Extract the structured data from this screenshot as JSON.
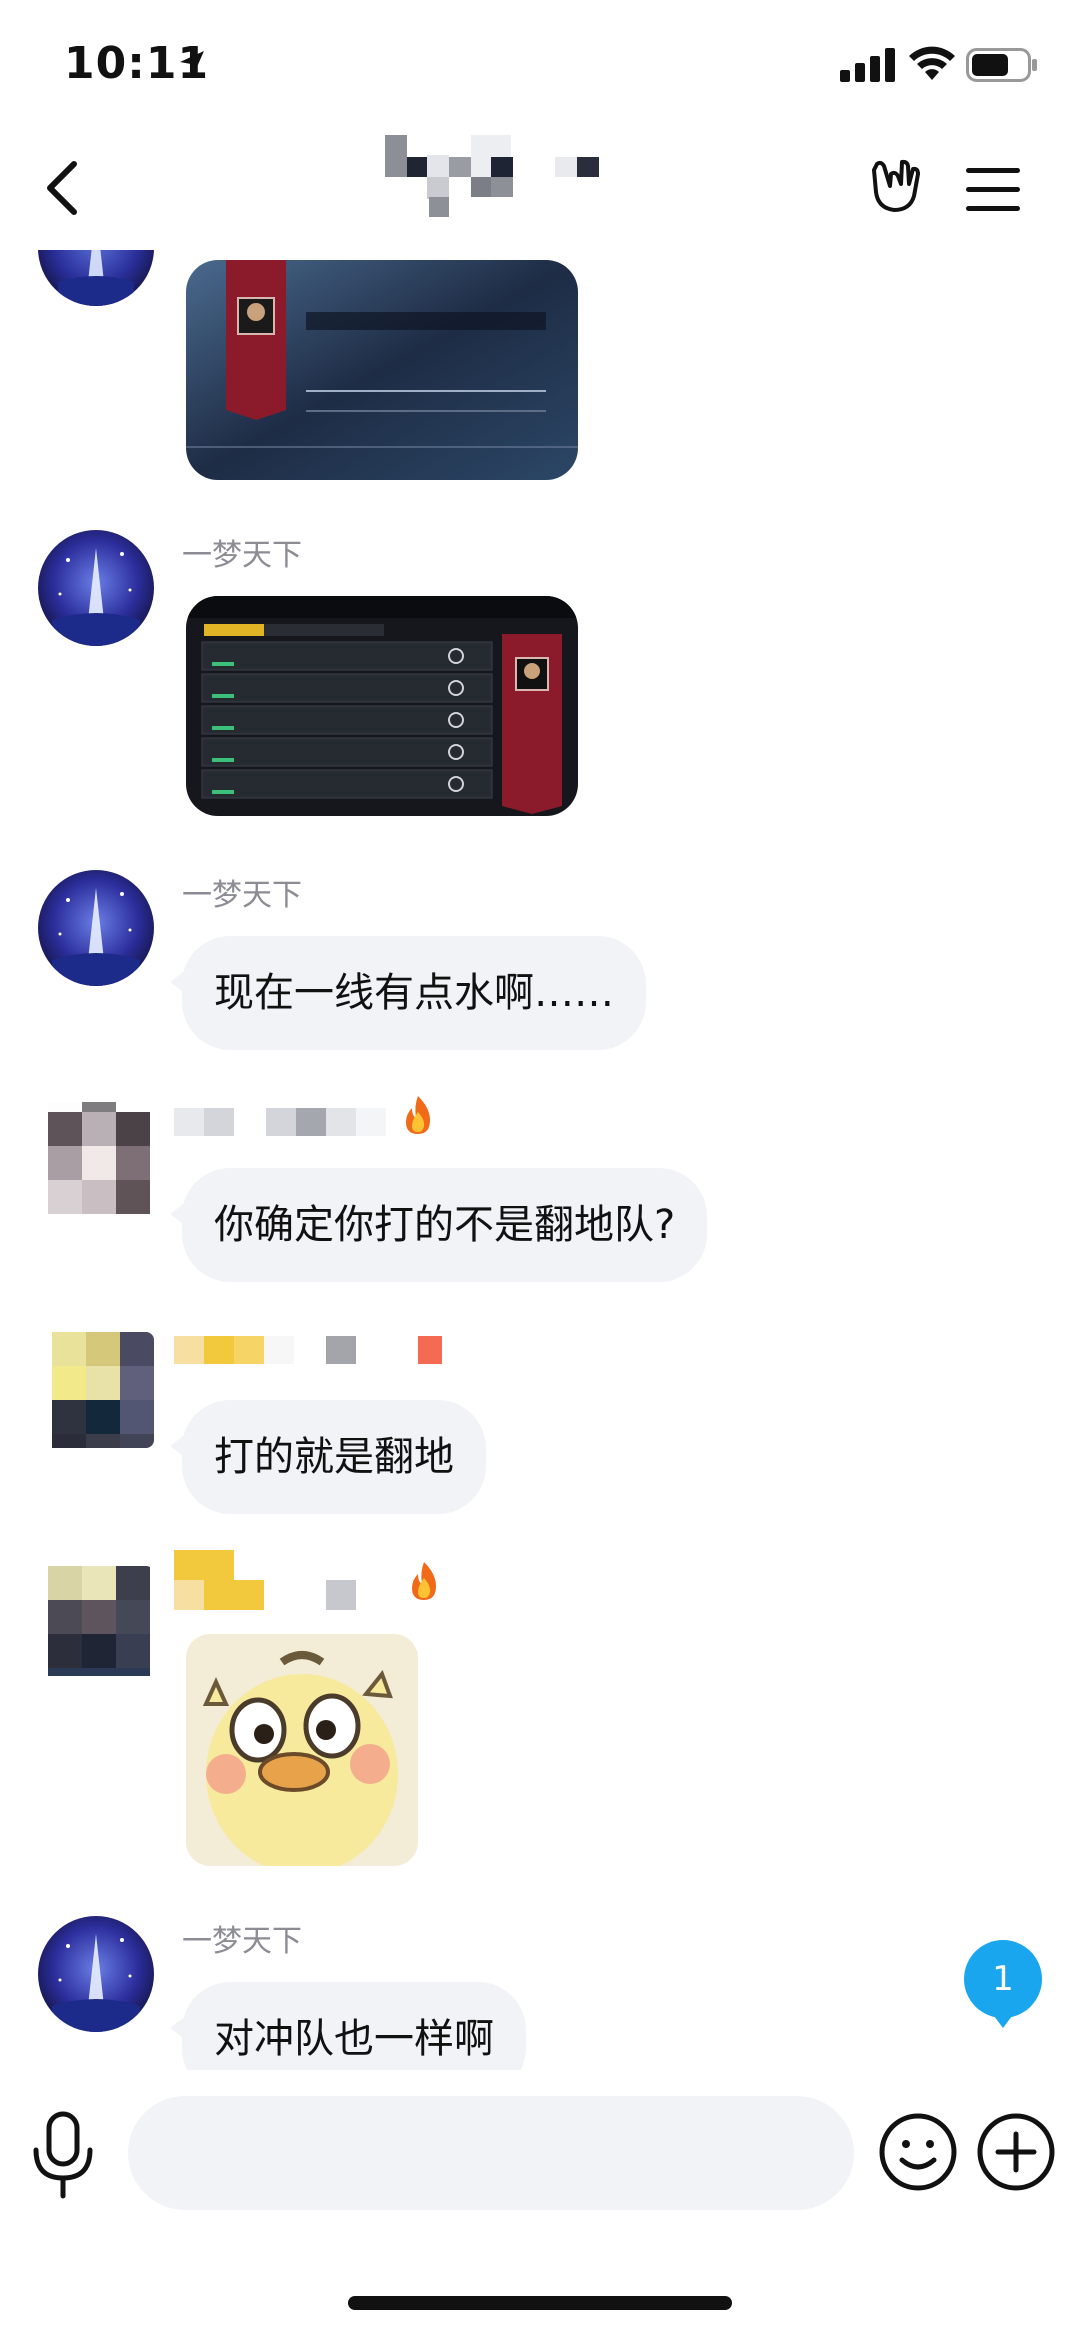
{
  "status_bar": {
    "time": "10:11"
  },
  "header": {
    "back_icon": "chevron-left-icon",
    "hand_icon": "rock-hand-icon",
    "menu_icon": "hamburger-menu-icon"
  },
  "messages": [
    {
      "sender": "",
      "kind": "image",
      "content": "game screenshot (result card)"
    },
    {
      "sender": "一梦天下",
      "kind": "image",
      "content": "game screenshot (match list)"
    },
    {
      "sender": "一梦天下",
      "kind": "text",
      "text": "现在一线有点水啊……"
    },
    {
      "sender": "",
      "kind": "text",
      "text": "你确定你打的不是翻地队?"
    },
    {
      "sender": "",
      "kind": "text",
      "text": "打的就是翻地"
    },
    {
      "sender": "",
      "kind": "sticker",
      "content": "duck sticker"
    },
    {
      "sender": "一梦天下",
      "kind": "text",
      "text": "对冲队也一样啊"
    }
  ],
  "unread_badge": {
    "count": "1"
  },
  "input": {
    "value": "",
    "placeholder": ""
  },
  "colors": {
    "bubble": "#f2f3f7",
    "badge": "#19a6ee",
    "sender_text": "#8c8c94",
    "game_red": "#8b1a2b"
  }
}
